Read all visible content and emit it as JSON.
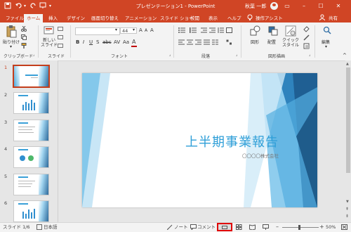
{
  "app": {
    "title": "プレゼンテーション1 - PowerPoint",
    "user": "秋葉 一郎",
    "share": "共有"
  },
  "tabs": [
    {
      "label": "ファイル"
    },
    {
      "label": "ホーム"
    },
    {
      "label": "挿入"
    },
    {
      "label": "デザイン"
    },
    {
      "label": "画面切り替え"
    },
    {
      "label": "アニメーション"
    },
    {
      "label": "スライド ショー"
    },
    {
      "label": "校閲"
    },
    {
      "label": "表示"
    },
    {
      "label": "ヘルプ"
    },
    {
      "label": "操作アシスト"
    }
  ],
  "ribbon": {
    "paste_label": "貼り付け",
    "new_slide_label": "新しい\nスライド",
    "font_size": "44",
    "shapes_label": "図形",
    "arrange_label": "配置",
    "quick_styles_label": "クイック\nスタイル",
    "edit_label": "編集",
    "groups": {
      "clipboard": "クリップボード",
      "slides": "スライド",
      "font": "フォント",
      "paragraph": "段落",
      "drawing": "図形描画"
    }
  },
  "thumbnails": [
    {
      "num": "1"
    },
    {
      "num": "2"
    },
    {
      "num": "3"
    },
    {
      "num": "4"
    },
    {
      "num": "5"
    },
    {
      "num": "6"
    }
  ],
  "slide": {
    "title": "上半期事業報告",
    "subtitle": "〇〇〇〇株式会社"
  },
  "status": {
    "slide_indicator": "スライド 1/6",
    "language": "日本語",
    "notes": "ノート",
    "comments": "コメント",
    "zoom": "50%"
  },
  "colors": {
    "accent": "#d04525",
    "slide_title": "#2f9fd8"
  }
}
